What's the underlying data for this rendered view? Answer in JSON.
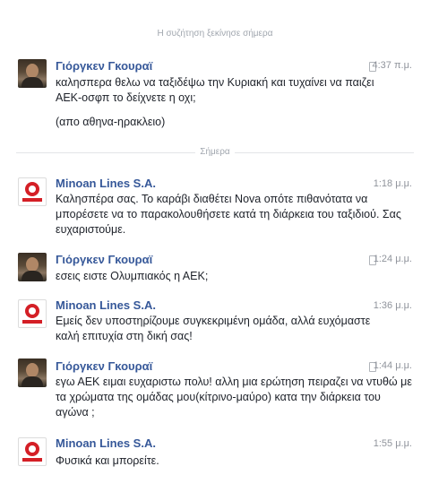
{
  "dividers": {
    "start": "Η συζήτηση ξεκίνησε σήμερα",
    "today": "Σήμερα"
  },
  "messages": [
    {
      "sender": "Γιόργκεν Γκουραϊ",
      "time": "4:37 π.μ.",
      "text": "καλησπερα θελω να ταξιδέψω την Κυριακή και τυχαίνει να παιζει ΑΕΚ-οσφπ το δείχνετε η οχι;",
      "text2": "(απο αθηνα-ηρακλειο)"
    },
    {
      "sender": "Minoan Lines S.A.",
      "time": "1:18 μ.μ.",
      "text": "Καλησπέρα σας. Το καράβι διαθέτει Nova οπότε πιθανότατα να μπορέσετε να το παρακολουθήσετε κατά τη διάρκεια του ταξιδιού. Σας ευχαριστούμε."
    },
    {
      "sender": "Γιόργκεν Γκουραϊ",
      "time": "1:24 μ.μ.",
      "text": "εσεις ειστε Ολυμπιακός η ΑΕΚ;"
    },
    {
      "sender": "Minoan Lines S.A.",
      "time": "1:36 μ.μ.",
      "text": "Εμείς δεν υποστηρίζουμε συγκεκριμένη ομάδα, αλλά ευχόμαστε καλή επιτυχία στη δική σας!"
    },
    {
      "sender": "Γιόργκεν Γκουραϊ",
      "time": "1:44 μ.μ.",
      "text": "εγω ΑΕΚ ειμαι ευχαριστω πολυ! αλλη μια ερώτηση πειραζει να ντυθώ με τα χρώματα της ομάδας μου(κίτρινο-μαύρο) κατα την διάρκεια του αγώνα ;"
    },
    {
      "sender": "Minoan Lines S.A.",
      "time": "1:55 μ.μ.",
      "text": "Φυσικά και μπορείτε."
    }
  ]
}
